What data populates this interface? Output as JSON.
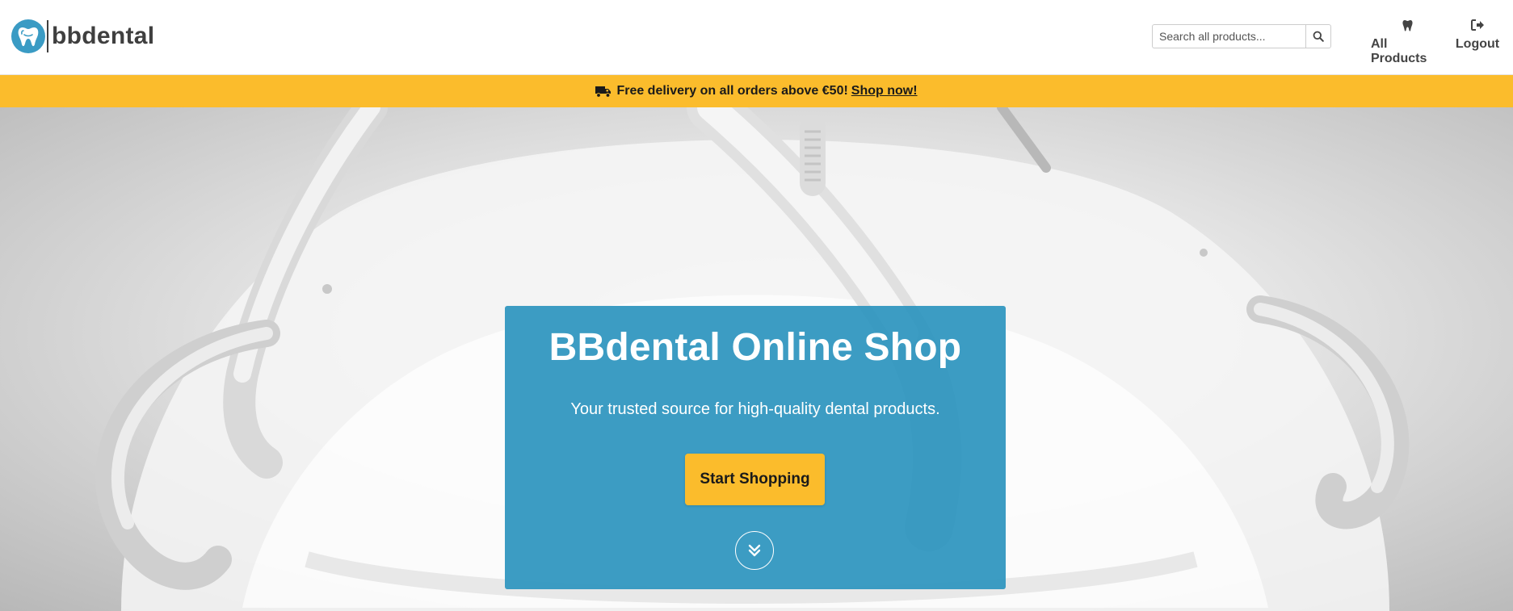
{
  "brand": {
    "name": "bbdental",
    "logo_icon": "tooth-logo-icon",
    "accent": "#3a9bc4"
  },
  "header": {
    "search": {
      "placeholder": "Search all products...",
      "value": "",
      "icon": "search-icon"
    },
    "nav": [
      {
        "label": "All Products",
        "icon": "tooth-icon"
      },
      {
        "label": "Logout",
        "icon": "logout-icon"
      }
    ]
  },
  "promo": {
    "icon": "truck-icon",
    "text": "Free delivery on all orders above €50!",
    "link_label": "Shop now!",
    "color": "#fbbc2c"
  },
  "hero": {
    "title": "BBdental Online Shop",
    "subtitle": "Your trusted source for high-quality dental products.",
    "cta_label": "Start Shopping",
    "scroll_icon": "double-chevron-down-icon",
    "card_color": "#2d94be"
  }
}
